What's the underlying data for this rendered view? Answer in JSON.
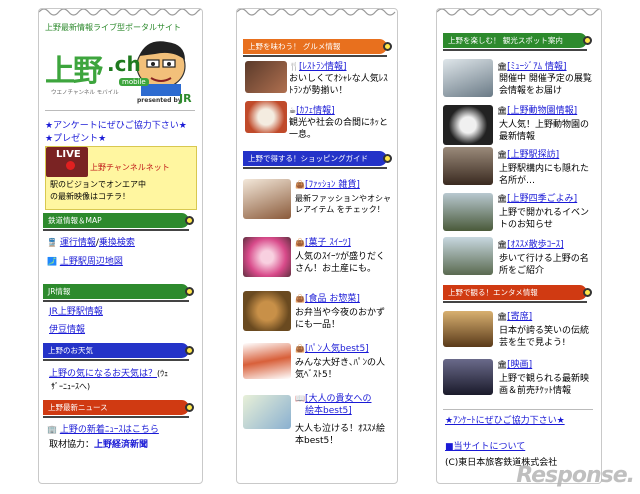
{
  "col1": {
    "site_title": "上野最新情報ライブ型ポータルサイト",
    "logo_main": "上野",
    "logo_sub": ".ch",
    "logo_mobile": "mobile",
    "logo_small": "ウエノチャンネル モバイル",
    "presented_by": "presented by",
    "jr_mark": "JR",
    "survey_link": "★アンケートにぜひご協力下さい★",
    "present_link": "★プレゼント★",
    "live_label": "LIVE",
    "live_channel": "上野チャンネルネット",
    "live_text1": "駅のビジョンでオンエア中",
    "live_text2": "の最新映像はコチラ！",
    "section_rail": "鉄道情報＆MAP",
    "rail_link1": "運行情報",
    "rail_sep": "/",
    "rail_link2": "乗換検索",
    "map_link": "上野駅周辺地図",
    "section_jr": "JR情報",
    "jr_link1": "JR上野駅情報",
    "jr_link2": "伊豆情報",
    "section_weather": "上野のお天気",
    "weather_link": "上野の気になるお天気は？",
    "weather_note1": "(ｳｪ",
    "weather_note2": "ｻﾞｰﾆｭｰｽへ)",
    "section_news": "上野最新ニュース",
    "news_link": "上野の新着ﾆｭｰｽはこちら",
    "coop_label": "取材協力：",
    "coop_value": "上野経済新聞"
  },
  "col2": {
    "section_gourmet": "上野を味わう！ グルメ情報",
    "restaurant_link": "[ﾚｽﾄﾗﾝ情報]",
    "restaurant_text": "おいしくてｵｼｬﾚな人気ﾚｽﾄﾗﾝが勢揃い！",
    "cafe_link": "[ｶﾌｪ情報]",
    "cafe_text": "観光や社会の合間にﾎｯと一息。",
    "section_shopping": "上野で得する！ショッピングガイド",
    "fashion_link": "[ﾌｧｯｼｮﾝ 雑貨]",
    "fashion_text": "最新ファッションやオシャレアイテム をチェック！",
    "sweets_link": "[菓子 ｽｲｰﾂ]",
    "sweets_text": "人気のｽｲｰﾂが盛りだくさん！お土産にも。",
    "food_link": "[食品 お惣菜]",
    "food_text": "お弁当や今夜のおかずにも一品！",
    "pan_link": "[ﾊﾟﾝ人気best5]",
    "pan_text": "みんな大好き､ﾊﾟﾝの人気ﾍﾞｽﾄ5！",
    "book_link1": "[大人の貴女への",
    "book_link2": "絵本best5]",
    "book_text": "大人も泣ける！ｵｽｽﾒ絵本best5！"
  },
  "col3": {
    "section_sightseeing": "上野を楽しむ！ 観光スポット案内",
    "museum_link": "[ﾐｭｰｼﾞｱﾑ 情報]",
    "museum_text": "開催中 開催予定の展覧会情報をお届け",
    "zoo_link": "[上野動物園情報]",
    "zoo_text": "大人気！上野動物園の最新情報",
    "station_link": "[上野駅探訪]",
    "station_text": "上野駅構内にも隠れた名所が…",
    "seasons_link": "[上野四季ごよみ]",
    "seasons_text": "上野で開かれるイベントのお知らせ",
    "walk_link": "[ｵｽｽﾒ散歩ｺｰｽ]",
    "walk_text": "歩いて行ける上野の名所をご紹介",
    "section_entertainment": "上野で観る！エンタメ情報",
    "yose_link": "[寄席]",
    "yose_text": "日本が誇る笑いの伝統芸を生で見よう!",
    "movie_link": "[映画]",
    "movie_text": "上野で観られる最新映画＆前売ﾁｹｯﾄ情報",
    "survey_link": "★ｱﾝｹｰﾄにぜひご協力下さい★",
    "about_link": "■当サイトについて",
    "copyright": "(C)東日本旅客鉄道株式会社"
  },
  "watermark": "Response."
}
